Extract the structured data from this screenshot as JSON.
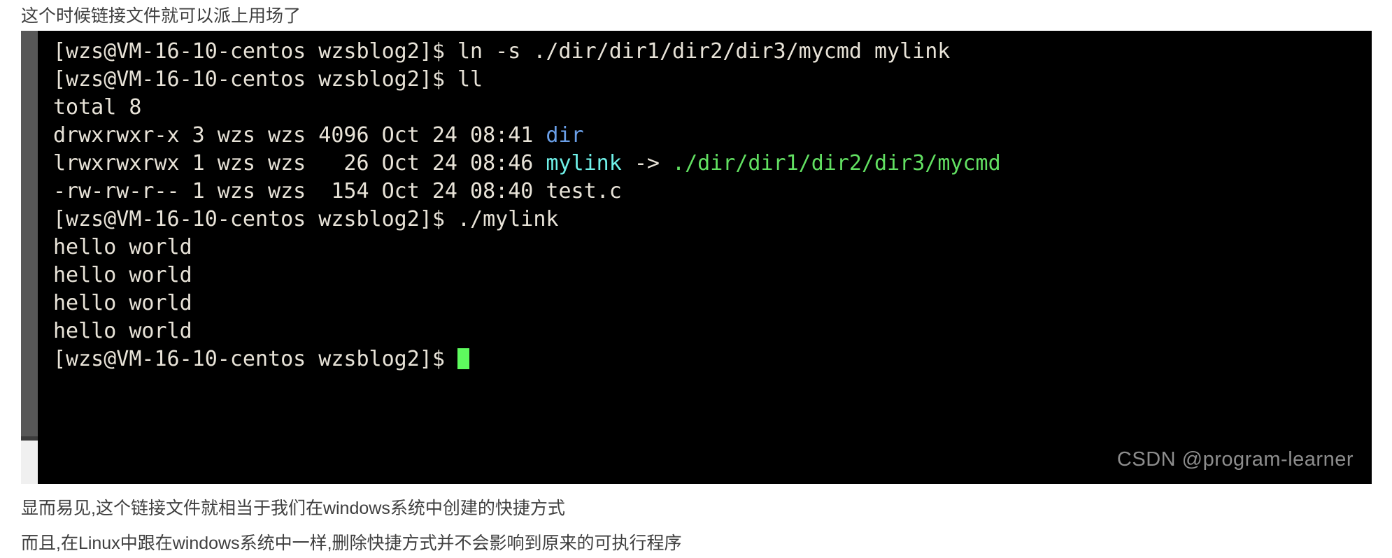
{
  "article": {
    "intro_text": "这个时候链接文件就可以派上用场了",
    "outro_line_1": "显而易见,这个链接文件就相当于我们在windows系统中创建的快捷方式",
    "outro_line_2": "而且,在Linux中跟在windows系统中一样,删除快捷方式并不会影响到原来的可执行程序"
  },
  "terminal": {
    "prompt": "[wzs@VM-16-10-centos wzsblog2]$ ",
    "colors": {
      "background": "#000000",
      "foreground": "#e8e3d8",
      "directory": "#6a9fe8",
      "symlink": "#6ff0e8",
      "executable": "#62e062",
      "cursor": "#5efb5e"
    },
    "lines": [
      {
        "id": "cmd-ln-s",
        "segments": [
          {
            "text": "[wzs@VM-16-10-centos wzsblog2]$ ",
            "color": "white"
          },
          {
            "text": "ln -s ./dir/dir1/dir2/dir3/mycmd mylink",
            "color": "white"
          }
        ]
      },
      {
        "id": "cmd-ll",
        "segments": [
          {
            "text": "[wzs@VM-16-10-centos wzsblog2]$ ",
            "color": "white"
          },
          {
            "text": "ll",
            "color": "white"
          }
        ]
      },
      {
        "id": "out-total",
        "segments": [
          {
            "text": "total 8",
            "color": "white"
          }
        ]
      },
      {
        "id": "out-dir",
        "segments": [
          {
            "text": "drwxrwxr-x 3 wzs wzs 4096 Oct 24 08:41 ",
            "color": "white"
          },
          {
            "text": "dir",
            "color": "blue"
          }
        ]
      },
      {
        "id": "out-mylink",
        "segments": [
          {
            "text": "lrwxrwxrwx 1 wzs wzs   26 Oct 24 08:46 ",
            "color": "white"
          },
          {
            "text": "mylink",
            "color": "cyan"
          },
          {
            "text": " -> ",
            "color": "white"
          },
          {
            "text": "./dir/dir1/dir2/dir3/mycmd",
            "color": "green"
          }
        ]
      },
      {
        "id": "out-testc",
        "segments": [
          {
            "text": "-rw-rw-r-- 1 wzs wzs  154 Oct 24 08:40 test.c",
            "color": "white"
          }
        ]
      },
      {
        "id": "cmd-run-mylink",
        "segments": [
          {
            "text": "[wzs@VM-16-10-centos wzsblog2]$ ",
            "color": "white"
          },
          {
            "text": "./mylink",
            "color": "white"
          }
        ]
      },
      {
        "id": "out-hello-1",
        "segments": [
          {
            "text": "hello world",
            "color": "white"
          }
        ]
      },
      {
        "id": "out-hello-2",
        "segments": [
          {
            "text": "hello world",
            "color": "white"
          }
        ]
      },
      {
        "id": "out-hello-3",
        "segments": [
          {
            "text": "hello world",
            "color": "white"
          }
        ]
      },
      {
        "id": "out-hello-4",
        "segments": [
          {
            "text": "hello world",
            "color": "white"
          }
        ]
      },
      {
        "id": "prompt-final",
        "cursor": true,
        "segments": [
          {
            "text": "[wzs@VM-16-10-centos wzsblog2]$ ",
            "color": "white"
          }
        ]
      }
    ]
  },
  "watermark": {
    "text": "CSDN @program-learner"
  }
}
